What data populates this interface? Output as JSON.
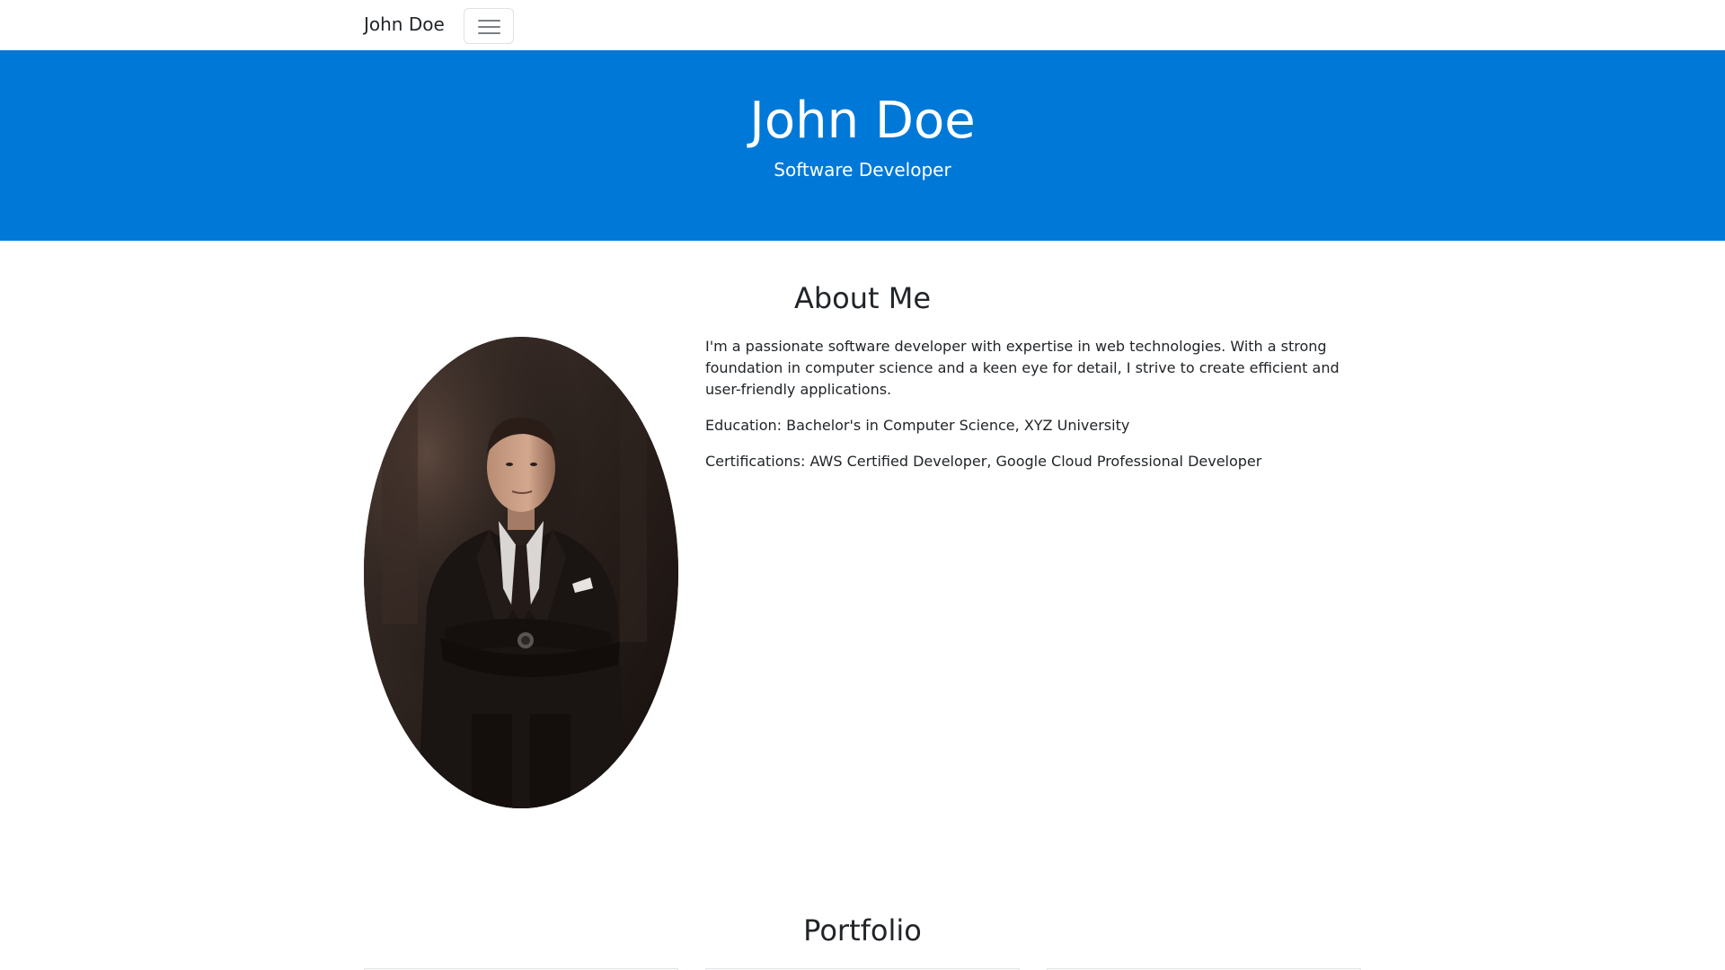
{
  "navbar": {
    "brand": "John Doe",
    "toggler_icon": "hamburger-menu-icon"
  },
  "hero": {
    "title": "John Doe",
    "subtitle": "Software Developer",
    "background_color": "#0078d7"
  },
  "about": {
    "heading": "About Me",
    "portrait_alt": "portrait photo",
    "paragraphs": [
      "I'm a passionate software developer with expertise in web technologies. With a strong foundation in computer science and a keen eye for detail, I strive to create efficient and user-friendly applications.",
      "Education: Bachelor's in Computer Science, XYZ University",
      "Certifications: AWS Certified Developer, Google Cloud Professional Developer"
    ]
  },
  "portfolio": {
    "heading": "Portfolio",
    "card_count_visible": 3
  }
}
